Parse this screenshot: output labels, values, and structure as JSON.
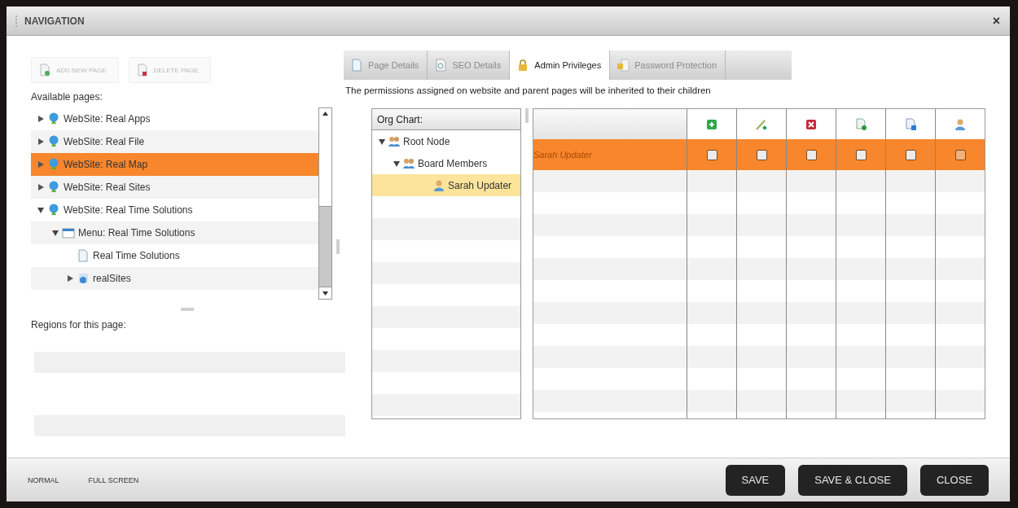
{
  "window": {
    "title": "NAVIGATION",
    "close": "×"
  },
  "page_buttons": [
    {
      "label": "ADD NEW PAGE",
      "kind": "add",
      "disabled": true
    },
    {
      "label": "DELETE PAGE",
      "kind": "delete",
      "disabled": true
    }
  ],
  "available_label": "Available pages:",
  "pages": [
    {
      "label": "WebSite: Real Apps",
      "kind": "site",
      "expanded": false,
      "selected": false
    },
    {
      "label": "WebSite: Real File",
      "kind": "site",
      "expanded": false,
      "selected": false
    },
    {
      "label": "WebSite: Real Map",
      "kind": "site",
      "expanded": false,
      "selected": true
    },
    {
      "label": "WebSite: Real Sites",
      "kind": "site",
      "expanded": false,
      "selected": false
    },
    {
      "label": "WebSite: Real Time Solutions",
      "kind": "site",
      "expanded": true,
      "selected": false,
      "children": [
        {
          "label": "Menu: Real Time Solutions",
          "kind": "menu",
          "expanded": true,
          "selected": false,
          "children": [
            {
              "label": "Real Time Solutions",
              "kind": "page",
              "selected": false
            },
            {
              "label": "realSites",
              "kind": "folder",
              "expanded": false,
              "selected": false
            }
          ]
        }
      ]
    }
  ],
  "regions_label": "Regions for this page:",
  "tabs": [
    {
      "label": "Page Details",
      "kind": "page",
      "selected": false,
      "disabled": true
    },
    {
      "label": "SEO Details",
      "kind": "seo",
      "selected": false,
      "disabled": true
    },
    {
      "label": "Admin Privileges",
      "kind": "lock",
      "selected": true,
      "disabled": false
    },
    {
      "label": "Password Protection",
      "kind": "lockpage",
      "selected": false,
      "disabled": true
    }
  ],
  "notice": "The permissions assigned on website and parent pages will be inherited to their children",
  "org_chart": {
    "title": "Org Chart:",
    "nodes": [
      {
        "label": "Root Node",
        "kind": "group",
        "expanded": true,
        "selected": false,
        "children": [
          {
            "label": "Board Members",
            "kind": "group",
            "expanded": true,
            "selected": false,
            "children": [
              {
                "label": "Sarah Updater",
                "kind": "user",
                "selected": true
              }
            ]
          }
        ]
      }
    ]
  },
  "permissions": {
    "columns": [
      {
        "kind": "add"
      },
      {
        "kind": "edit"
      },
      {
        "kind": "delete"
      },
      {
        "kind": "page-add"
      },
      {
        "kind": "page-copy"
      },
      {
        "kind": "user"
      }
    ],
    "rows": [
      {
        "name": "Sarah Updater",
        "selected": true,
        "checks": [
          {
            "checked": false,
            "disabled": false
          },
          {
            "checked": false,
            "disabled": false
          },
          {
            "checked": false,
            "disabled": false
          },
          {
            "checked": false,
            "disabled": false
          },
          {
            "checked": false,
            "disabled": false
          },
          {
            "checked": false,
            "disabled": true
          }
        ]
      }
    ]
  },
  "view_links": [
    "NORMAL",
    "FULL SCREEN"
  ],
  "actions": [
    "SAVE",
    "SAVE & CLOSE",
    "CLOSE"
  ]
}
